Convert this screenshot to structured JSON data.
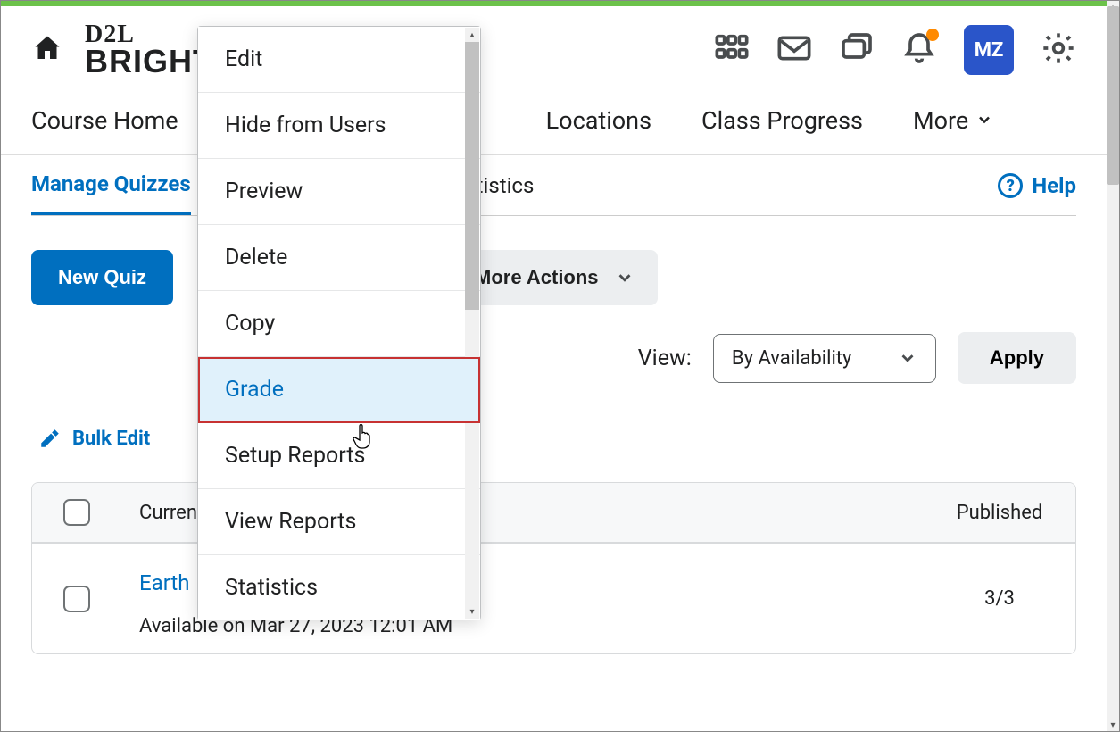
{
  "logo": {
    "line1": "D2L",
    "line2": "BRIGHTS"
  },
  "topbar": {
    "avatar_initials": "MZ"
  },
  "nav": {
    "items": [
      "Course Home",
      "Locations",
      "Class Progress"
    ],
    "more_label": "More"
  },
  "subtabs": {
    "active": "Manage Quizzes",
    "partial_label": "tistics",
    "help_label": "Help"
  },
  "toolbar": {
    "new_quiz": "New Quiz",
    "more_actions": "More Actions"
  },
  "view": {
    "label": "View:",
    "selected": "By Availability",
    "apply": "Apply"
  },
  "bulk_edit_label": "Bulk Edit",
  "table": {
    "col_current_partial": "Curren",
    "col_published": "Published",
    "rows": [
      {
        "title": "Earth",
        "availability": "Available on Mar 27, 2023 12:01 AM",
        "published": "3/3"
      }
    ]
  },
  "context_menu": {
    "items": [
      "Edit",
      "Hide from Users",
      "Preview",
      "Delete",
      "Copy",
      "Grade",
      "Setup Reports",
      "View Reports",
      "Statistics"
    ],
    "highlight_index": 5
  }
}
